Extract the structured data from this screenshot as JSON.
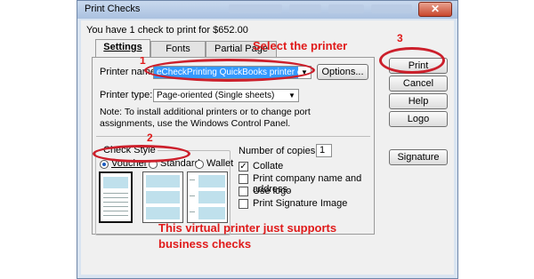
{
  "window": {
    "title": "Print Checks",
    "close_symbol": "✕"
  },
  "info_line": "You have 1 check to print for $652.00",
  "tabs": [
    {
      "label": "Settings"
    },
    {
      "label": "Fonts"
    },
    {
      "label": "Partial Page"
    }
  ],
  "settings": {
    "printer_name_label": "Printer name:",
    "printer_name_value": "eCheckPrinting QuickBooks printer on ...",
    "options_label": "Options...",
    "printer_type_label": "Printer type:",
    "printer_type_value": "Page-oriented (Single sheets)",
    "note": "Note: To install additional printers or to change port assignments, use the Windows Control Panel.",
    "check_style_label": "Check Style",
    "styles": [
      {
        "label": "Voucher",
        "selected": true
      },
      {
        "label": "Standard",
        "selected": false
      },
      {
        "label": "Wallet",
        "selected": false
      }
    ],
    "copies_label": "Number of copies:",
    "copies_value": "1",
    "checkboxes": [
      {
        "label": "Collate",
        "checked": true
      },
      {
        "label": "Print company name and address.",
        "checked": false
      },
      {
        "label": "Use logo",
        "checked": false
      },
      {
        "label": "Print Signature Image",
        "checked": false
      }
    ]
  },
  "buttons": {
    "print": "Print",
    "cancel": "Cancel",
    "help": "Help",
    "logo": "Logo",
    "signature": "Signature"
  },
  "annotations": {
    "step1": "1",
    "step2": "2",
    "step3": "3",
    "select_printer": "Select the printer",
    "virtual_note_line1": "This virtual printer just supports",
    "virtual_note_line2": "business checks",
    "annotation_color": "#e01a1a"
  }
}
